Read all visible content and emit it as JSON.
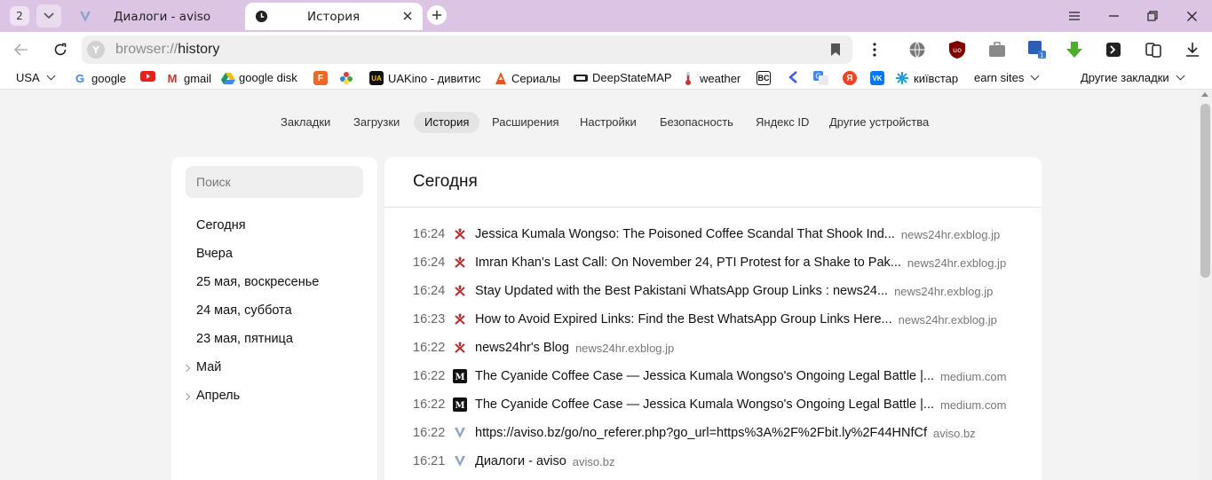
{
  "tabs": {
    "count": "2",
    "inactive": {
      "title": "Диалоги - aviso"
    },
    "active": {
      "title": "История"
    }
  },
  "address": {
    "scheme": "browser://",
    "path": "history"
  },
  "bookmarks": [
    {
      "label": "USA",
      "icon": "dropdown-caret"
    },
    {
      "label": "google",
      "icon": "google-icon"
    },
    {
      "label": "",
      "icon": "youtube-icon"
    },
    {
      "label": "gmail",
      "icon": "gmail-icon"
    },
    {
      "label": "google disk",
      "icon": "google-drive-icon"
    },
    {
      "label": "",
      "icon": "f-app-icon"
    },
    {
      "label": "",
      "icon": "flower-icon"
    },
    {
      "label": "UAKino - дивитис",
      "icon": "uakino-icon"
    },
    {
      "label": "Сериалы",
      "icon": "fox-icon"
    },
    {
      "label": "DeepStateMAP",
      "icon": "deepstate-icon"
    },
    {
      "label": "weather",
      "icon": "thermometer-icon"
    },
    {
      "label": "",
      "icon": "bc-icon"
    },
    {
      "label": "",
      "icon": "arrow-icon"
    },
    {
      "label": "",
      "icon": "translate-icon"
    },
    {
      "label": "",
      "icon": "yandex-icon"
    },
    {
      "label": "",
      "icon": "vk-icon"
    },
    {
      "label": "київстар",
      "icon": "kyivstar-icon"
    },
    {
      "label": "earn sites",
      "icon": "folder-caret"
    }
  ],
  "other_bookmarks": "Другие закладки",
  "settings_nav": [
    {
      "label": "Закладки"
    },
    {
      "label": "Загрузки"
    },
    {
      "label": "История",
      "active": true
    },
    {
      "label": "Расширения"
    },
    {
      "label": "Настройки"
    },
    {
      "label": "Безопасность"
    },
    {
      "label": "Яндекс ID"
    },
    {
      "label": "Другие устройства"
    }
  ],
  "sidebar": {
    "search_placeholder": "Поиск",
    "dates": [
      {
        "label": "Сегодня",
        "expandable": false
      },
      {
        "label": "Вчера",
        "expandable": false
      },
      {
        "label": "25 мая, воскресенье",
        "expandable": false
      },
      {
        "label": "24 мая, суббота",
        "expandable": false
      },
      {
        "label": "23 мая, пятница",
        "expandable": false
      },
      {
        "label": "Май",
        "expandable": true
      },
      {
        "label": "Апрель",
        "expandable": true
      }
    ]
  },
  "history": {
    "heading": "Сегодня",
    "entries": [
      {
        "time": "16:24",
        "icon": "exblog-icon",
        "title": "Jessica Kumala Wongso: The Poisoned Coffee Scandal That Shook Ind...",
        "domain": "news24hr.exblog.jp"
      },
      {
        "time": "16:24",
        "icon": "exblog-icon",
        "title": "Imran Khan's Last Call: On November 24, PTI Protest for a Shake to Pak...",
        "domain": "news24hr.exblog.jp"
      },
      {
        "time": "16:24",
        "icon": "exblog-icon",
        "title": "Stay Updated with the Best Pakistani WhatsApp Group Links : news24...",
        "domain": "news24hr.exblog.jp"
      },
      {
        "time": "16:23",
        "icon": "exblog-icon",
        "title": "How to Avoid Expired Links: Find the Best WhatsApp Group Links Here...",
        "domain": "news24hr.exblog.jp"
      },
      {
        "time": "16:22",
        "icon": "exblog-icon",
        "title": "news24hr's Blog",
        "domain": "news24hr.exblog.jp"
      },
      {
        "time": "16:22",
        "icon": "medium-icon",
        "title": "The Cyanide Coffee Case — Jessica Kumala Wongso's Ongoing Legal Battle |...",
        "domain": "medium.com"
      },
      {
        "time": "16:22",
        "icon": "medium-icon",
        "title": "The Cyanide Coffee Case — Jessica Kumala Wongso's Ongoing Legal Battle |...",
        "domain": "medium.com"
      },
      {
        "time": "16:22",
        "icon": "aviso-icon",
        "title": "https://aviso.bz/go/no_referer.php?go_url=https%3A%2F%2Fbit.ly%2F44HNfCf",
        "domain": "aviso.bz"
      },
      {
        "time": "16:21",
        "icon": "aviso-icon",
        "title": "Диалоги - aviso",
        "domain": "aviso.bz"
      }
    ]
  },
  "colors": {
    "tabstrip": "#dcc4e4",
    "page_bg": "#f3f3f3",
    "panel_bg": "#ffffff"
  }
}
